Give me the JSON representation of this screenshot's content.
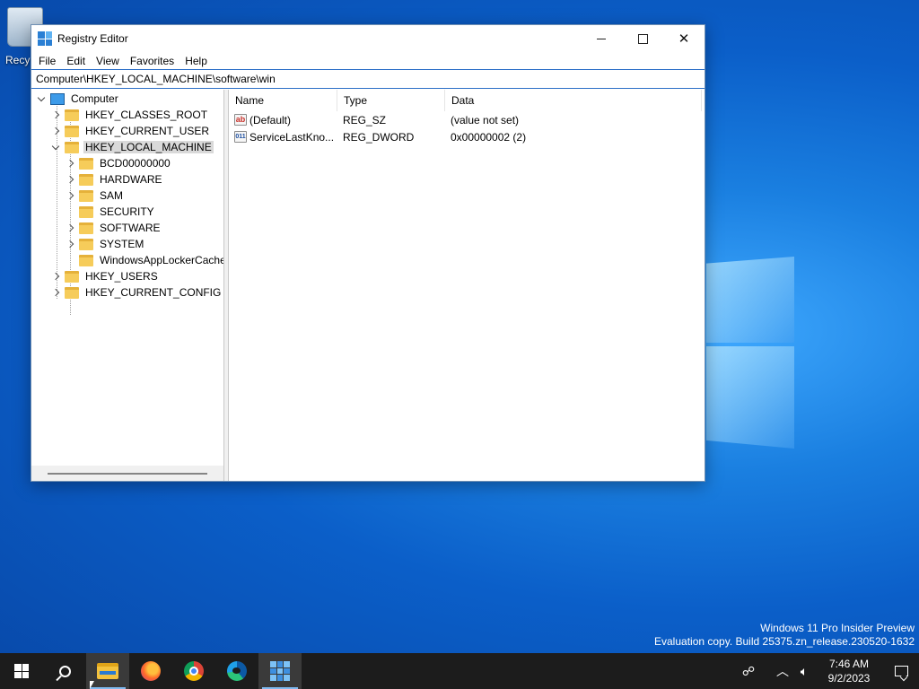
{
  "desktop": {
    "recycle_bin_label": "Recy",
    "watermark_line1": "Windows 11 Pro Insider Preview",
    "watermark_line2": "Evaluation copy. Build 25375.zn_release.230520-1632"
  },
  "window": {
    "title": "Registry Editor",
    "menu": [
      "File",
      "Edit",
      "View",
      "Favorites",
      "Help"
    ],
    "address": "Computer\\HKEY_LOCAL_MACHINE\\software\\win"
  },
  "tree": {
    "root": "Computer",
    "hives": [
      "HKEY_CLASSES_ROOT",
      "HKEY_CURRENT_USER",
      "HKEY_LOCAL_MACHINE",
      "HKEY_USERS",
      "HKEY_CURRENT_CONFIG"
    ],
    "hklm_children": [
      "BCD00000000",
      "HARDWARE",
      "SAM",
      "SECURITY",
      "SOFTWARE",
      "SYSTEM",
      "WindowsAppLockerCache"
    ]
  },
  "values": {
    "columns": [
      "Name",
      "Type",
      "Data"
    ],
    "rows": [
      {
        "name": "(Default)",
        "type": "REG_SZ",
        "data": "(value not set)",
        "icon": "ab"
      },
      {
        "name": "ServiceLastKno...",
        "type": "REG_DWORD",
        "data": "0x00000002 (2)",
        "icon": "011"
      }
    ]
  },
  "taskbar": {
    "time": "7:46 AM",
    "date": "9/2/2023"
  }
}
